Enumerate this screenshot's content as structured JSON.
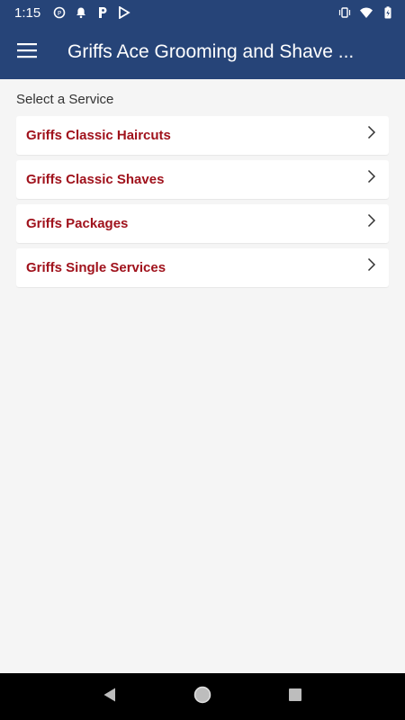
{
  "status_bar": {
    "time": "1:15",
    "left_icons": [
      "data-saver-icon",
      "notification-bell-icon",
      "parking-app-icon",
      "play-store-icon"
    ],
    "right_icons": [
      "vibrate-icon",
      "wifi-icon",
      "battery-charging-icon"
    ]
  },
  "app_bar": {
    "title": "Griffs Ace Grooming and Shave ...",
    "menu_icon": "hamburger-menu-icon"
  },
  "main": {
    "section_label": "Select a Service",
    "services": [
      {
        "label": "Griffs Classic Haircuts"
      },
      {
        "label": "Griffs Classic Shaves"
      },
      {
        "label": "Griffs Packages"
      },
      {
        "label": "Griffs Single Services"
      }
    ]
  },
  "nav_bar": {
    "buttons": [
      "back-icon",
      "home-icon",
      "recents-icon"
    ]
  },
  "colors": {
    "primary": "#264478",
    "accent_text": "#a0121c",
    "background": "#f5f5f5"
  }
}
